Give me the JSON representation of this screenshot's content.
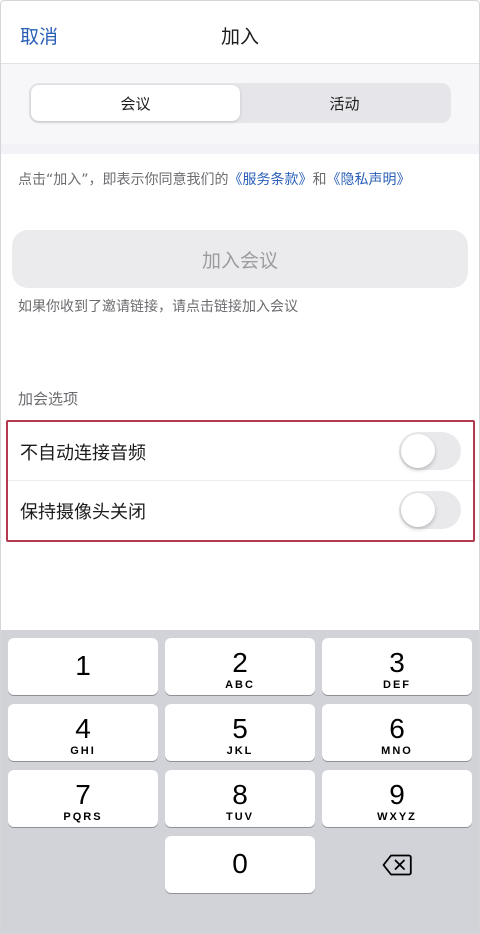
{
  "nav": {
    "cancel": "取消",
    "title": "加入"
  },
  "tabs": [
    {
      "label": "会议",
      "active": true
    },
    {
      "label": "活动",
      "active": false
    }
  ],
  "terms": {
    "prefix": "点击“加入”，即表示你同意我们的",
    "service_link": "《服务条款》",
    "and": "和",
    "privacy_link": "《隐私声明》"
  },
  "join_button": "加入会议",
  "hint": "如果你收到了邀请链接，请点击链接加入会议",
  "options": {
    "title": "加会选项",
    "items": [
      {
        "label": "不自动连接音频",
        "on": false
      },
      {
        "label": "保持摄像头关闭",
        "on": false
      }
    ]
  },
  "keypad": {
    "keys": [
      {
        "num": "1",
        "letters": ""
      },
      {
        "num": "2",
        "letters": "ABC"
      },
      {
        "num": "3",
        "letters": "DEF"
      },
      {
        "num": "4",
        "letters": "GHI"
      },
      {
        "num": "5",
        "letters": "JKL"
      },
      {
        "num": "6",
        "letters": "MNO"
      },
      {
        "num": "7",
        "letters": "PQRS"
      },
      {
        "num": "8",
        "letters": "TUV"
      },
      {
        "num": "9",
        "letters": "WXYZ"
      },
      {
        "num": "0",
        "letters": ""
      }
    ],
    "delete_icon": "backspace-icon"
  },
  "colors": {
    "link": "#2a5fb8",
    "highlight_border": "#b23a4e",
    "keypad_bg": "#d1d3d9"
  }
}
